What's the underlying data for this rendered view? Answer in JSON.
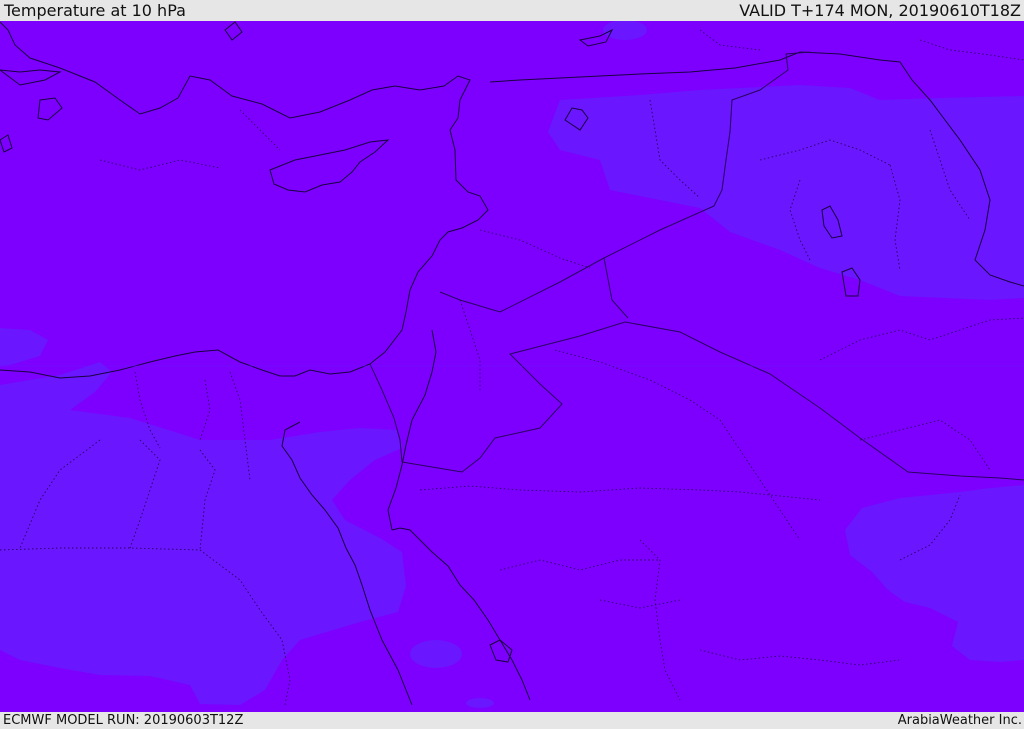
{
  "header": {
    "title": "Temperature at 10 hPa",
    "valid": "VALID T+174 MON, 20190610T18Z"
  },
  "footer": {
    "model_run": "ECMWF MODEL RUN: 20190603T12Z",
    "provider": "ArabiaWeather Inc."
  },
  "map": {
    "colors": {
      "warm_band": "#7d00ff",
      "cool_band": "#6a16ff",
      "coastline": "#1a0040",
      "border": "#2a0060",
      "background": "#e6e6e6"
    }
  }
}
